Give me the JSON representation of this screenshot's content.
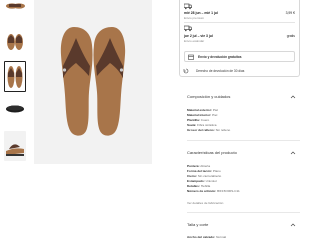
{
  "gallery": {
    "thumbnails": [
      {
        "name": "thumb-top-view"
      },
      {
        "name": "thumb-pair-front"
      },
      {
        "name": "thumb-pair-top-selected"
      },
      {
        "name": "thumb-sole"
      },
      {
        "name": "thumb-side"
      }
    ]
  },
  "shipping": {
    "options": [
      {
        "date": "mié 28 jun – mié 1 jul",
        "sub": "Envío premium",
        "price": "3,99 €"
      },
      {
        "date": "jue 2 jul – vie 3 jul",
        "sub": "Envío estándar",
        "price": "gratis"
      }
    ],
    "free_returns": "Envío y devolución gratuitos",
    "return_window": "Derecho de devolución de 30 días"
  },
  "composition": {
    "title": "Composición y cuidados",
    "specs": [
      {
        "label": "Material exterior:",
        "value": "Piel"
      },
      {
        "label": "Material interior:",
        "value": "Piel"
      },
      {
        "label": "Plantilla:",
        "value": "Cuero"
      },
      {
        "label": "Suela:",
        "value": "Fibra sintética"
      },
      {
        "label": "Grosor del relleno:",
        "value": "Sin relleno"
      }
    ]
  },
  "features": {
    "title": "Características del producto",
    "specs": [
      {
        "label": "Puntera:",
        "value": "Abierta"
      },
      {
        "label": "Forma del tacón:",
        "value": "Plano"
      },
      {
        "label": "Cierre:",
        "value": "Sin cierre/abierto"
      },
      {
        "label": "Estampado:",
        "value": "Unicolor"
      },
      {
        "label": "Detalles:",
        "value": "Hebilla"
      },
      {
        "label": "Número de artículo:",
        "value": "BIF15O00S-C11"
      }
    ],
    "more_link": "Ver detalles de fabricación"
  },
  "size": {
    "title": "Talla y corte",
    "spec_label": "Ancho del calzado:",
    "spec_value": "Normal"
  },
  "colors": {
    "sandal_strap": "#5a3a2c",
    "footbed": "#a8754a",
    "photo_bg": "#f2f2f2"
  }
}
